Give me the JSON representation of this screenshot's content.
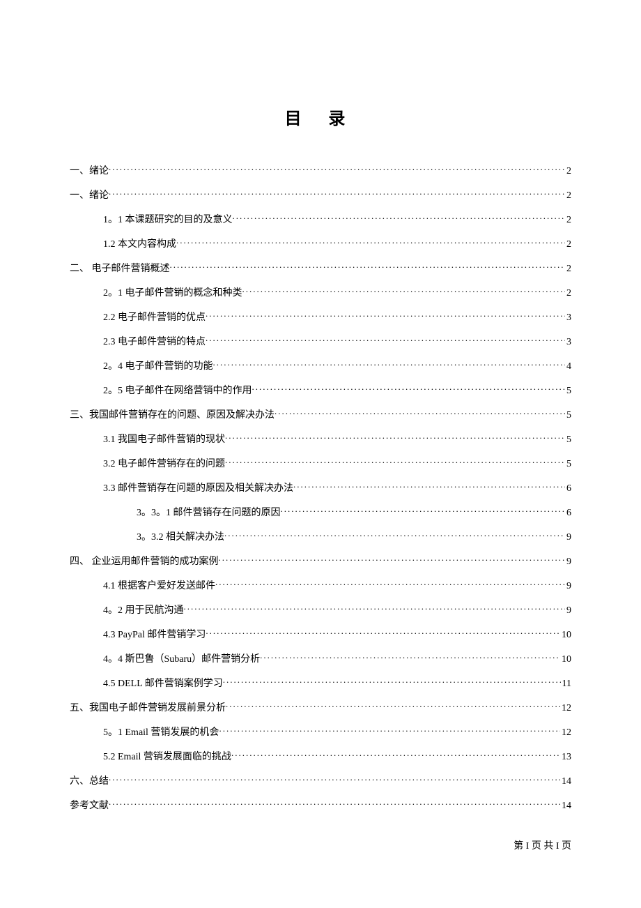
{
  "title": "目 录",
  "toc": [
    {
      "level": 1,
      "label": "一、绪论",
      "page": "2"
    },
    {
      "level": 1,
      "label": "一、绪论",
      "page": "2"
    },
    {
      "level": 2,
      "label": "1。1 本课题研究的目的及意义",
      "page": "2"
    },
    {
      "level": 2,
      "label": "1.2 本文内容构成",
      "page": "2"
    },
    {
      "level": 1,
      "label": "二、 电子邮件营销概述",
      "page": "2"
    },
    {
      "level": 2,
      "label": "2。1 电子邮件营销的概念和种类",
      "page": "2"
    },
    {
      "level": 2,
      "label": "2.2 电子邮件营销的优点",
      "page": "3"
    },
    {
      "level": 2,
      "label": "2.3 电子邮件营销的特点",
      "page": "3"
    },
    {
      "level": 2,
      "label": "2。4 电子邮件营销的功能",
      "page": "4"
    },
    {
      "level": 2,
      "label": "2。5 电子邮件在网络营销中的作用",
      "page": "5"
    },
    {
      "level": 1,
      "label": "三、我国邮件营销存在的问题、原因及解决办法",
      "page": "5"
    },
    {
      "level": 2,
      "label": "3.1 我国电子邮件营销的现状",
      "page": "5"
    },
    {
      "level": 2,
      "label": "3.2 电子邮件营销存在的问题",
      "page": "5"
    },
    {
      "level": 2,
      "label": "3.3 邮件营销存在问题的原因及相关解决办法",
      "page": "6"
    },
    {
      "level": 3,
      "label": "3。3。1 邮件营销存在问题的原因",
      "page": "6"
    },
    {
      "level": 3,
      "label": "3。3.2 相关解决办法",
      "page": "9"
    },
    {
      "level": 1,
      "label": "四、 企业运用邮件营销的成功案例",
      "page": "9"
    },
    {
      "level": 2,
      "label": "4.1 根据客户爱好发送邮件",
      "page": "9"
    },
    {
      "level": 2,
      "label": "4。2 用于民航沟通",
      "page": "9"
    },
    {
      "level": 2,
      "label": "4.3 PayPal 邮件营销学习",
      "page": "10"
    },
    {
      "level": 2,
      "label": "4。4 斯巴鲁（Subaru）邮件营销分析",
      "page": "10"
    },
    {
      "level": 2,
      "label": "4.5 DELL 邮件营销案例学习",
      "page": "11"
    },
    {
      "level": 1,
      "label": "五、我国电子邮件营销发展前景分析",
      "page": "12"
    },
    {
      "level": 2,
      "label": "5。1 Email 营销发展的机会",
      "page": "12"
    },
    {
      "level": 2,
      "label": "5.2 Email 营销发展面临的挑战",
      "page": "13"
    },
    {
      "level": 1,
      "label": "六、总结",
      "page": "14"
    },
    {
      "level": 1,
      "label": "参考文献",
      "page": "14"
    }
  ],
  "footer": "第 I 页  共 I 页"
}
